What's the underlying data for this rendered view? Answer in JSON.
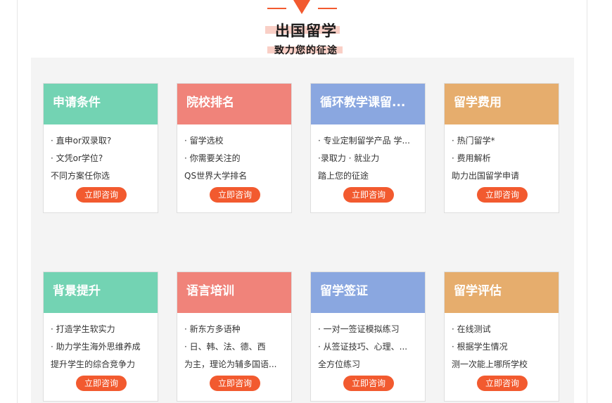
{
  "header": {
    "title": "出国留学",
    "subtitle": "致力您的征途"
  },
  "colors": {
    "accent": "#f25a2f",
    "green": "#73d3b3",
    "red": "#f0837a",
    "blue": "#8aa7e0",
    "orange": "#e6ad6d"
  },
  "cards": [
    {
      "title": "申请条件",
      "lines": [
        "· 直申or双录取?",
        "· 文凭or学位?",
        "不同方案任你选"
      ],
      "button": "立即咨询"
    },
    {
      "title": "院校排名",
      "lines": [
        "· 留学选校",
        "· 你需要关注的",
        "QS世界大学排名"
      ],
      "button": "立即咨询"
    },
    {
      "title": "循环教学课留...",
      "lines": [
        "· 专业定制留学产品 学...",
        "·录取力 · 就业力",
        "踏上您的征途"
      ],
      "button": "立即咨询"
    },
    {
      "title": "留学费用",
      "lines": [
        "· 热门留学*",
        "· 费用解析",
        "助力出国留学申请"
      ],
      "button": "立即咨询"
    },
    {
      "title": "背景提升",
      "lines": [
        "· 打造学生软实力",
        "· 助力学生海外思维养成",
        "提升学生的综合竞争力"
      ],
      "button": "立即咨询"
    },
    {
      "title": "语言培训",
      "lines": [
        "· 新东方多语种",
        "· 日、韩、法、德、西",
        "为主，理论为辅多国语..."
      ],
      "button": "立即咨询"
    },
    {
      "title": "留学签证",
      "lines": [
        "· 一对一签证模拟练习",
        "· 从签证技巧、心理、...",
        "全方位练习"
      ],
      "button": "立即咨询"
    },
    {
      "title": "留学评估",
      "lines": [
        "· 在线测试",
        "· 根据学生情况",
        "测一次能上哪所学校"
      ],
      "button": "立即咨询"
    }
  ]
}
